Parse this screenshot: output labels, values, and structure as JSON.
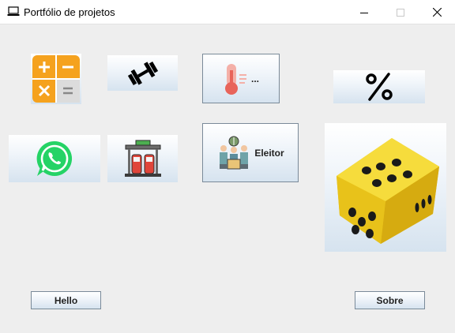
{
  "window": {
    "title": "Portfólio de projetos",
    "icon": "laptop-icon",
    "controls": [
      "minimize-icon",
      "maximize-icon",
      "close-icon"
    ]
  },
  "buttons": {
    "calculator": {
      "icon": "calculator-icon"
    },
    "fitness": {
      "icon": "dumbbell-icon"
    },
    "temperature": {
      "icon": "thermometer-icon",
      "label": "..."
    },
    "percent": {
      "icon": "percent-icon"
    },
    "whatsapp": {
      "icon": "whatsapp-icon"
    },
    "gas_station": {
      "icon": "gas-station-icon"
    },
    "voter": {
      "icon": "voters-icon",
      "label": "Eleitor"
    },
    "dice": {
      "icon": "dice-icon"
    },
    "hello": {
      "label": "Hello"
    },
    "about": {
      "label": "Sobre"
    }
  },
  "colors": {
    "calculator_orange": "#f5a21e",
    "whatsapp_green": "#25d366",
    "dice_yellow": "#f2d21a",
    "thermometer_red": "#e8645a"
  }
}
